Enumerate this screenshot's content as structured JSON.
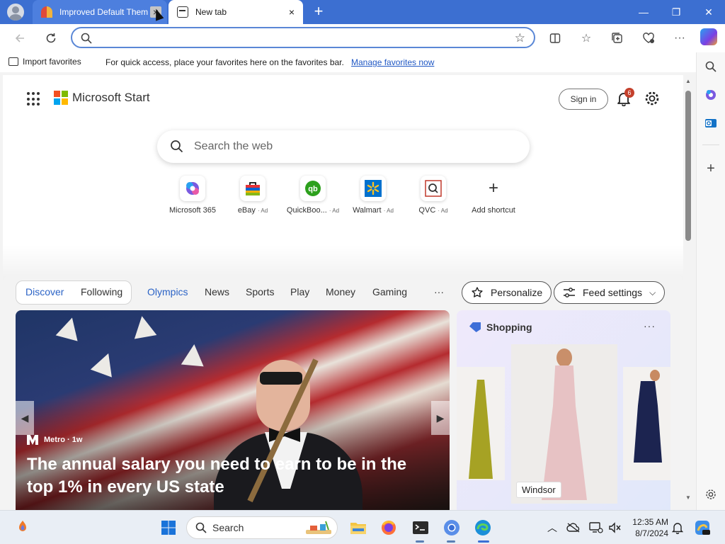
{
  "browser": {
    "tabs": [
      {
        "title": "Improved Default Them",
        "close": "×"
      },
      {
        "title": "New tab",
        "close": "×"
      }
    ],
    "new_tab_symbol": "+",
    "window_controls": {
      "minimize": "—",
      "maximize": "❐",
      "close": "✕"
    },
    "address": {
      "value": "",
      "placeholder": ""
    },
    "favorites_bar": {
      "import_label": "Import favorites",
      "note": "For quick access, place your favorites here on the favorites bar.",
      "link": "Manage favorites now"
    }
  },
  "start": {
    "brand": "Microsoft Start",
    "sign_in": "Sign in",
    "notification_count": "6",
    "search_placeholder": "Search the web",
    "shortcuts": [
      {
        "name": "Microsoft 365",
        "ad": ""
      },
      {
        "name": "eBay",
        "ad": "· Ad"
      },
      {
        "name": "QuickBoo...",
        "ad": "· Ad"
      },
      {
        "name": "Walmart",
        "ad": "· Ad"
      },
      {
        "name": "QVC",
        "ad": "· Ad"
      },
      {
        "name": "Add shortcut",
        "ad": ""
      }
    ],
    "nav": {
      "discover": "Discover",
      "following": "Following",
      "olympics": "Olympics",
      "news": "News",
      "sports": "Sports",
      "play": "Play",
      "money": "Money",
      "gaming": "Gaming",
      "more": "···",
      "personalize": "Personalize",
      "feed_settings": "Feed settings"
    },
    "hero": {
      "source": "Metro · 1w",
      "title": "The annual salary you need to earn to be in the top 1% in every US state"
    },
    "shopping": {
      "title": "Shopping",
      "more": "···",
      "featured_label": "Windsor"
    }
  },
  "taskbar": {
    "search_label": "Search",
    "time": "12:35 AM",
    "date": "8/7/2024"
  },
  "colors": {
    "titlebar": "#3c6fd1",
    "accent": "#2b63c6",
    "notification_badge": "#c4402c"
  }
}
